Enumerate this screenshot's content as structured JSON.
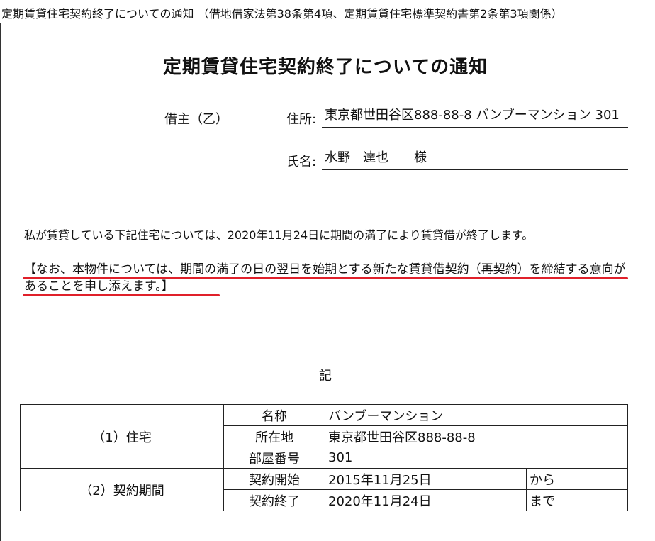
{
  "header": {
    "caption": "定期賃貸住宅契約終了についての通知 （借地借家法第38条第4項、定期賃貸住宅標準契約書第2条第3項関係）"
  },
  "document": {
    "title": "定期賃貸住宅契約終了についての通知",
    "lessee_label": "借主（乙）",
    "address_label": "住所:",
    "address_value": "東京都世田谷区888-88-8 バンブーマンション 301",
    "name_label": "氏名:",
    "name_value": "水野　達也　　様",
    "paragraph1": "私が賃貸している下記住宅については、2020年11月24日に期間の満了により賃貸借が終了します。",
    "paragraph2": "【なお、本物件については、期間の満了の日の翌日を始期とする新たな賃貸借契約（再契約）を締結する意向があることを申し添えます。】",
    "ki": "記",
    "underline_color": "#e0202a"
  },
  "table": {
    "housing_label": "（1）住宅",
    "name_label": "名称",
    "name_value": "バンブーマンション",
    "location_label": "所在地",
    "location_value": "東京都世田谷区888-88-8",
    "room_label": "部屋番号",
    "room_value": "301",
    "period_label": "（2）契約期間",
    "start_label": "契約開始",
    "start_value": "2015年11月25日",
    "start_suffix": "から",
    "end_label": "契約終了",
    "end_value": "2020年11月24日",
    "end_suffix": "まで"
  }
}
